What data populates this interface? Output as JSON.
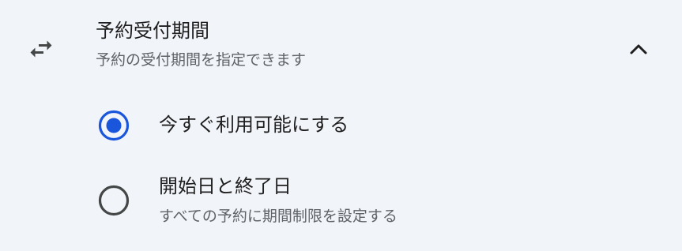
{
  "colors": {
    "background": "#f1f4f9",
    "accent": "#1a56db",
    "text_primary": "#1f1f1f",
    "text_secondary": "#5f6368",
    "radio_unselected": "#444746"
  },
  "section": {
    "icon": "swap-horiz-icon",
    "title": "予約受付期間",
    "subtitle": "予約の受付期間を指定できます",
    "toggle_icon": "chevron-up-icon",
    "expanded": true
  },
  "options": [
    {
      "label": "今すぐ利用可能にする",
      "description": "",
      "selected": true
    },
    {
      "label": "開始日と終了日",
      "description": "すべての予約に期間制限を設定する",
      "selected": false
    }
  ]
}
